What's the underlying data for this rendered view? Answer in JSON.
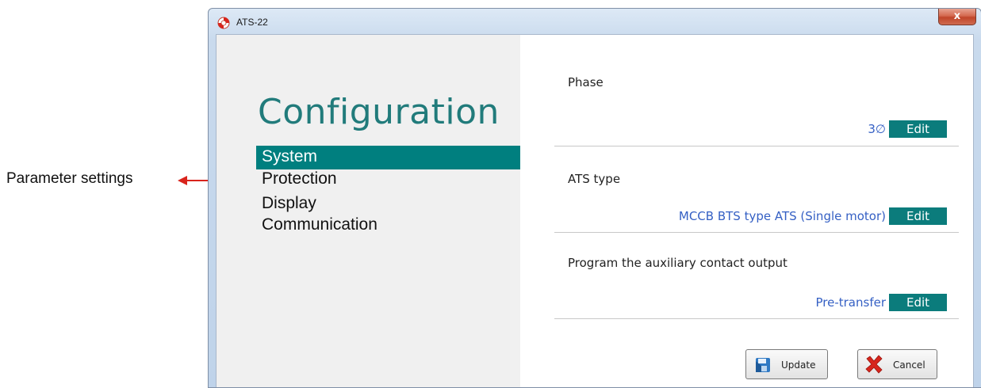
{
  "annotation": {
    "label": "Parameter settings"
  },
  "window": {
    "title": "ATS-22",
    "close_label": "x"
  },
  "sidebar": {
    "title": "Configuration",
    "items": [
      {
        "label": "System",
        "active": true
      },
      {
        "label": "Protection",
        "active": false
      },
      {
        "label": "Display",
        "active": false
      },
      {
        "label": "Communication",
        "active": false
      }
    ]
  },
  "settings": [
    {
      "label": "Phase",
      "value": "3∅",
      "edit_label": "Edit"
    },
    {
      "label": "ATS type",
      "value": "MCCB BTS type ATS (Single motor)",
      "edit_label": "Edit"
    },
    {
      "label": "Program the auxiliary contact output",
      "value": "Pre-transfer",
      "edit_label": "Edit"
    }
  ],
  "buttons": {
    "update_label": "Update",
    "cancel_label": "Cancel"
  },
  "colors": {
    "accent": "#007f7f",
    "value_text": "#3560c4",
    "title_text": "#217b7b",
    "annotation": "#d9241c"
  },
  "icons": {
    "app": "lifebuoy-icon",
    "update": "save-disk-icon",
    "cancel": "red-x-icon"
  }
}
